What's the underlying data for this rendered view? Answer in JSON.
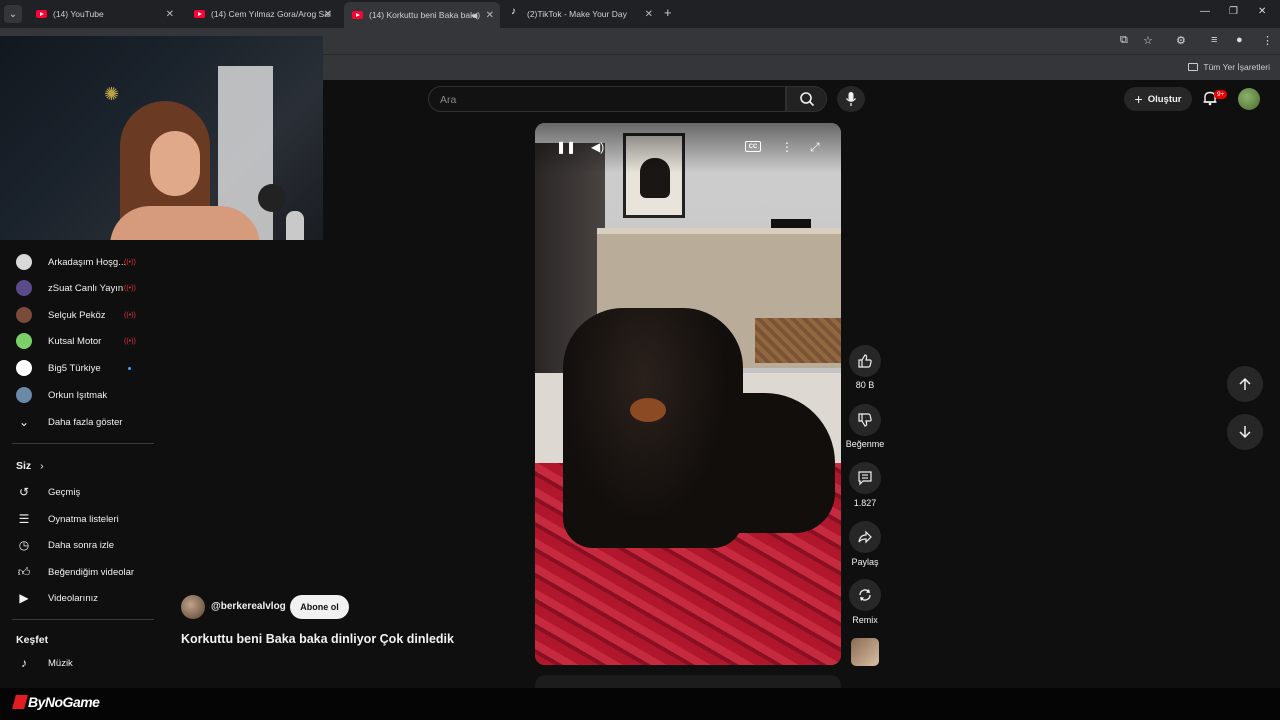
{
  "browser": {
    "tabs": [
      {
        "label": "(14) YouTube",
        "active": false
      },
      {
        "label": "(14) Cem Yılmaz Gora/Arog Sal",
        "active": false
      },
      {
        "label": "(14) Korkuttu beni Baka bak",
        "active": true
      },
      {
        "label": "(2)TikTok - Make Your Day",
        "active": false
      }
    ],
    "bookmarks_label": "Tüm Yer İşaretleri"
  },
  "header": {
    "search_placeholder": "Ara",
    "create_label": "Oluştur",
    "notifications_badge": "9+"
  },
  "sidebar": {
    "subscriptions": [
      {
        "label": "Arkadaşım Hoşg...",
        "live": true,
        "color": "#d9d9d9"
      },
      {
        "label": "zSuat Canlı Yayın",
        "live": true,
        "color": "#5a4a8a"
      },
      {
        "label": "Selçuk Peköz",
        "live": true,
        "color": "#7a4a3a"
      },
      {
        "label": "Kutsal Motor",
        "live": true,
        "color": "#7bd06a"
      },
      {
        "label": "Big5 Türkiye",
        "live": false,
        "new": true,
        "color": "#ffffff"
      },
      {
        "label": "Orkun Işıtmak",
        "live": false,
        "color": "#6a8aa8"
      }
    ],
    "show_more": "Daha fazla göster",
    "you_section": "Siz",
    "you_items": [
      {
        "label": "Geçmiş",
        "icon": "history-icon"
      },
      {
        "label": "Oynatma listeleri",
        "icon": "playlists-icon"
      },
      {
        "label": "Daha sonra izle",
        "icon": "watch-later-icon"
      },
      {
        "label": "Beğendiğim videolar",
        "icon": "liked-icon"
      },
      {
        "label": "Videolarınız",
        "icon": "your-videos-icon"
      }
    ],
    "explore_section": "Keşfet",
    "explore_items": [
      {
        "label": "Müzik",
        "icon": "music-icon"
      }
    ]
  },
  "short": {
    "channel": "@berkerealvlog",
    "subscribe": "Abone ol",
    "title": "Korkuttu beni Baka baka dinliyor Çok dinledik",
    "likes": "80 B",
    "dislike_label": "Beğenme",
    "comments": "1.827",
    "share_label": "Paylaş",
    "remix_label": "Remix"
  },
  "overlay": {
    "brand": "ByNoGame"
  }
}
